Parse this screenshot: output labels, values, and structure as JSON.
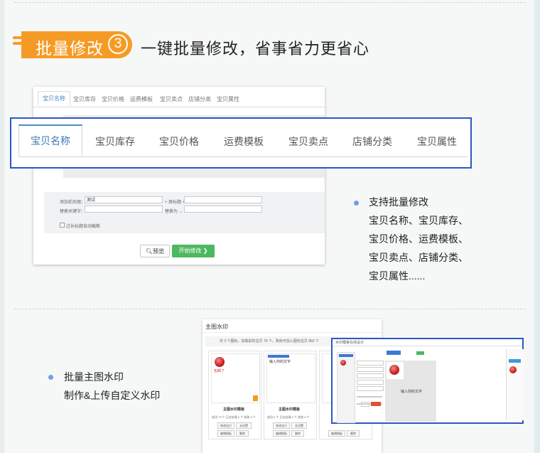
{
  "section1": {
    "badge_text": "批量修改",
    "badge_number": "3",
    "headline": "一键批量修改，省事省力更省心"
  },
  "shot1": {
    "tabs": [
      "宝贝名称",
      "宝贝库存",
      "宝贝价格",
      "运费模板",
      "宝贝卖点",
      "店铺分类",
      "宝贝属性"
    ],
    "form": {
      "prefix_label": "添加前后缀：",
      "prefix_value": "测试",
      "origin_label": "+ 原标题 +",
      "replace_label": "替换关键字：",
      "replace_to_label": "替换为 →",
      "checkbox_label": "过长标题自动截断"
    },
    "preview_button": "预览",
    "start_button": "开始修改"
  },
  "zoom_tabs": [
    "宝贝名称",
    "宝贝库存",
    "宝贝价格",
    "运费模板",
    "宝贝卖点",
    "店铺分类",
    "宝贝属性"
  ],
  "bullet1": {
    "title": "支持批量修改",
    "lines": [
      "宝贝名称、宝贝库存、",
      "宝贝价格、运费模板、",
      "宝贝卖点、店铺分类、",
      "宝贝属性......"
    ]
  },
  "bullet2": {
    "title": "批量主图水印",
    "line": "制作&上传自定义水印"
  },
  "shot2": {
    "title": "主图水印",
    "info": "共 3 个图标，加载前的宝贝 76 个，剩余可加入图标宝贝 882 个",
    "cards": [
      {
        "tag": "包邮了",
        "name": "主图水印模板",
        "stats": "成功 73 个  正在处理 0 个  失败 3 个",
        "btn1": "修改宝贝",
        "btn2": "去设置",
        "btn3": "编辑模板",
        "btn4": "删除"
      },
      {
        "tag": "输入你的文字",
        "name": "主图水印模板",
        "stats": "成功 0 个  正在处理 0 个  失败 0 个",
        "btn1": "修改宝贝",
        "btn2": "去设置",
        "btn3": "编辑模板",
        "btn4": "删除"
      },
      {
        "tag": "",
        "name": "",
        "stats": "",
        "btn1": "",
        "btn2": "",
        "btn3": "编辑模板",
        "btn4": "删除"
      }
    ]
  },
  "dialog": {
    "title": "水印模板在线设计",
    "canvas_text": "输入你的文字",
    "save_label": "保存",
    "cancel_label": "取消"
  },
  "colors": {
    "accent_orange": "#f59b25",
    "highlight_blue": "#2f56c2",
    "green_button": "#4cb860",
    "bullet_dot": "#6f9fe0"
  }
}
